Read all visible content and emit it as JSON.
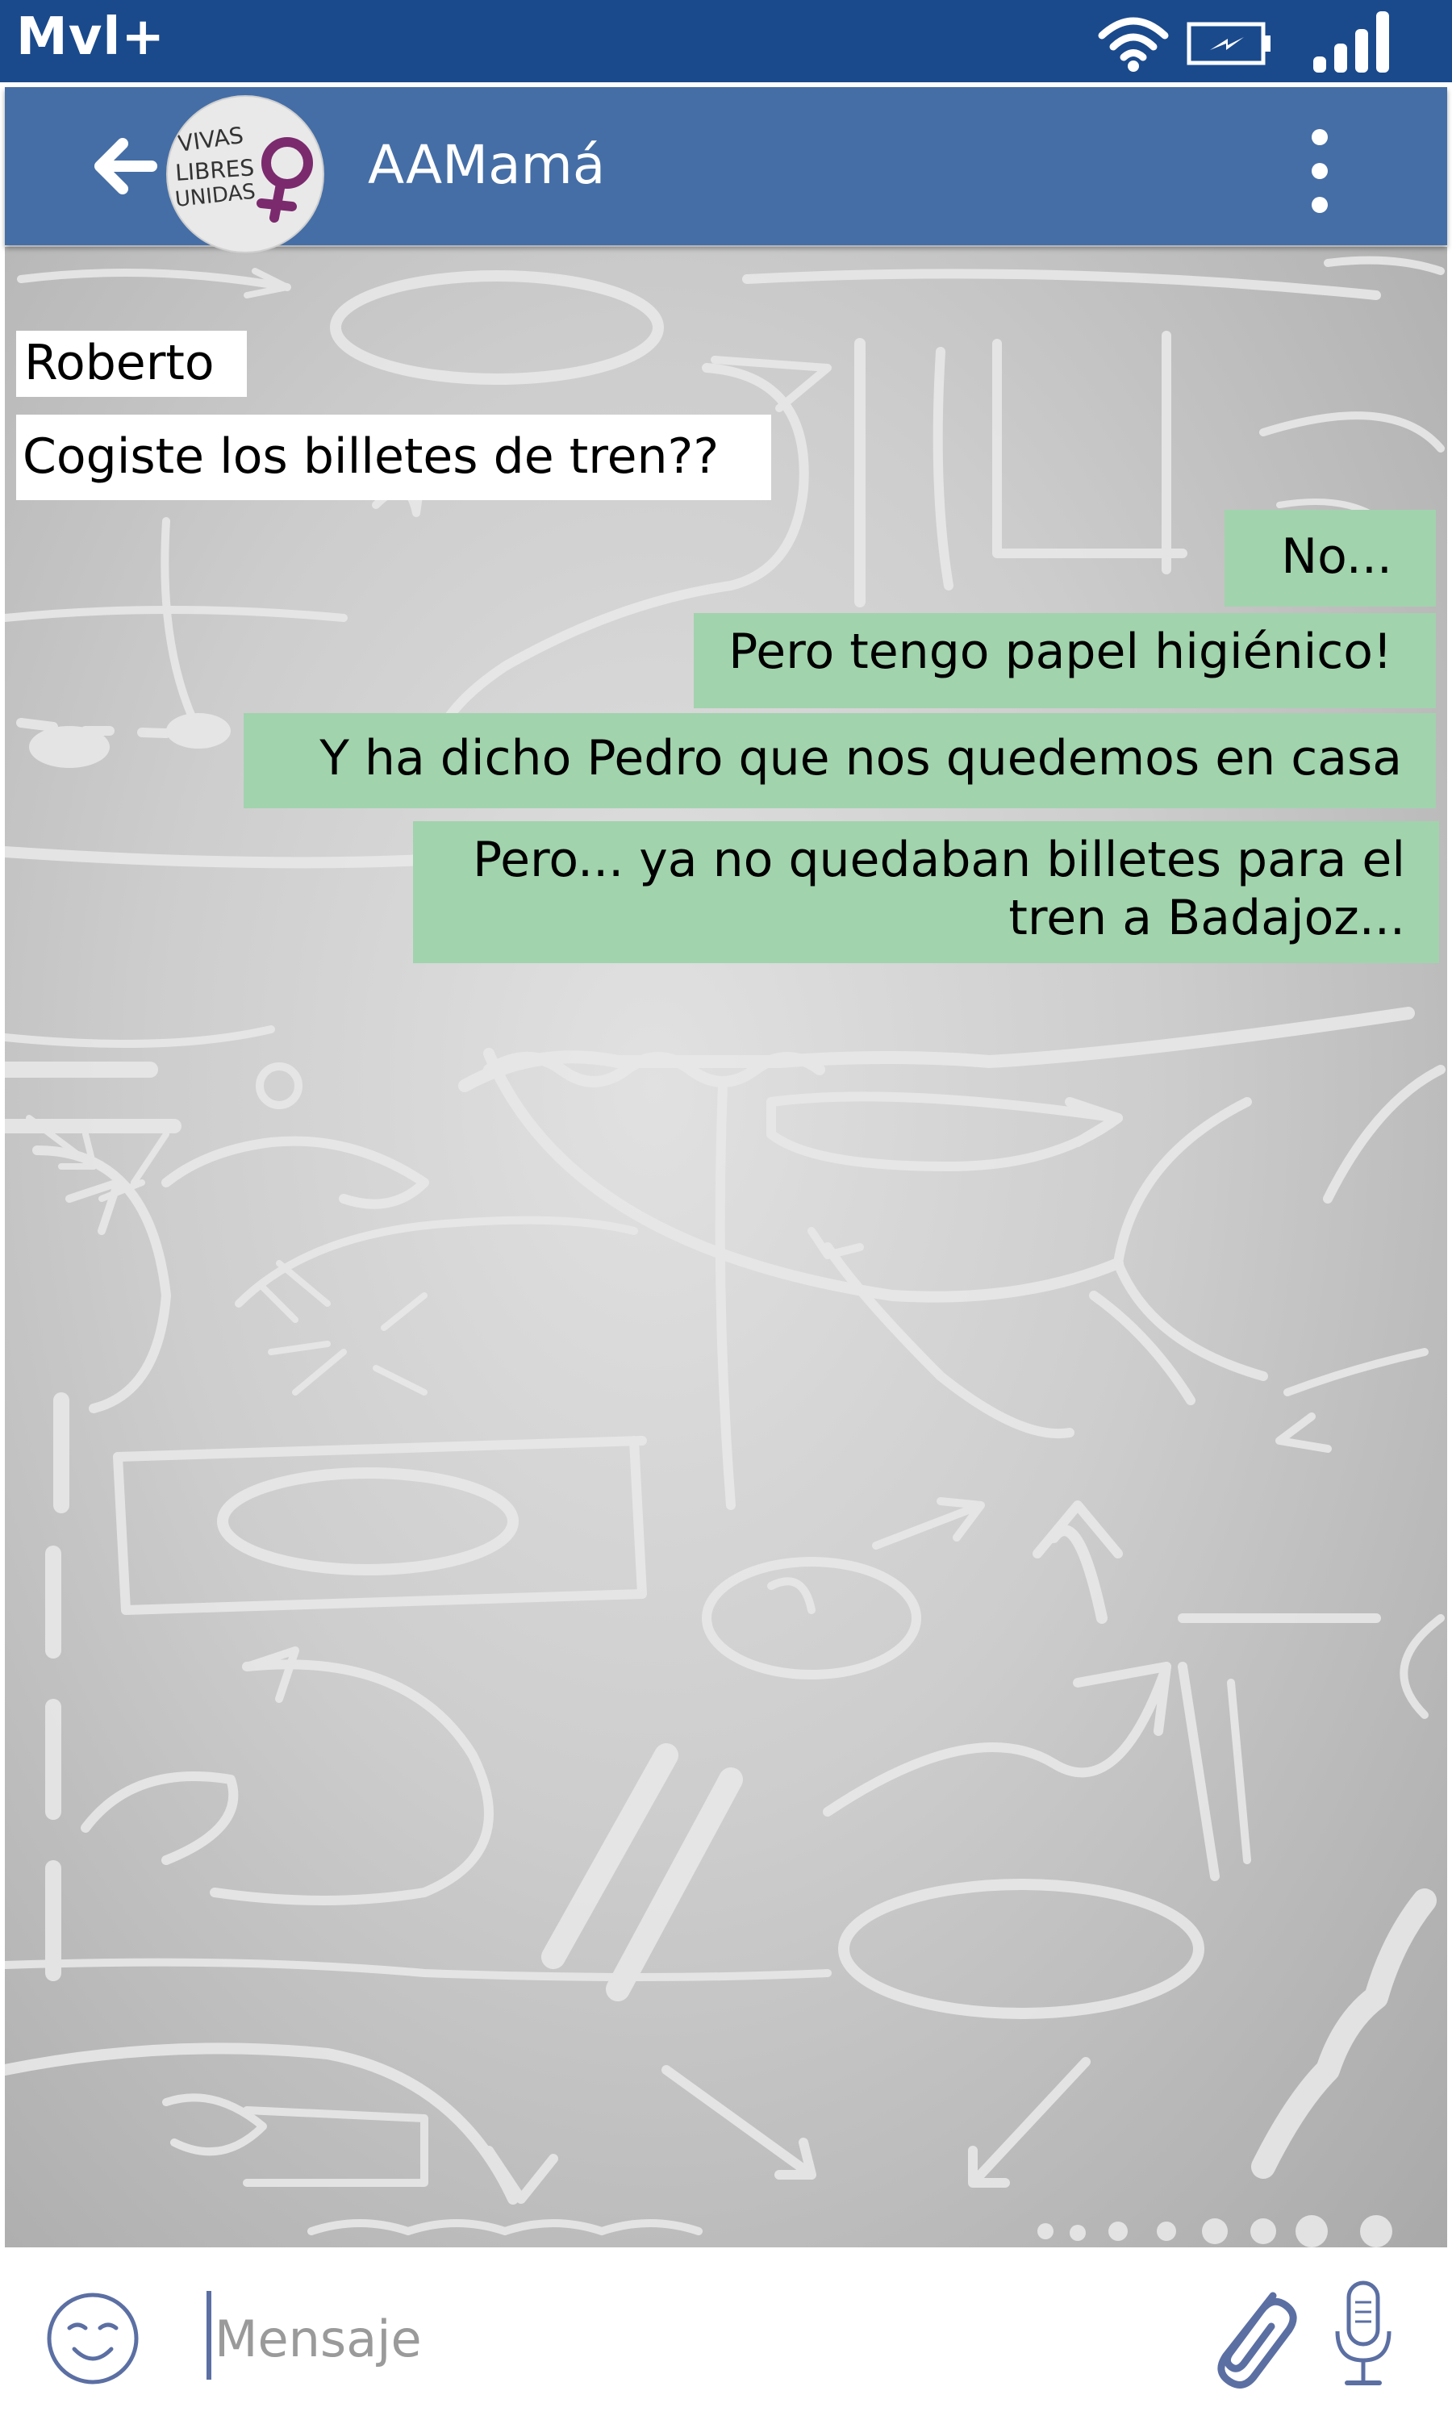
{
  "status_bar": {
    "carrier": "Mvl+",
    "icons": [
      "wifi-icon",
      "battery-charging-icon",
      "signal-icon"
    ],
    "background": "#1a4a8c"
  },
  "header": {
    "title": "AAMamá",
    "avatar_text": [
      "VIVAS",
      "LIBRES",
      "UNIDAS"
    ],
    "avatar_symbol_color": "#7b2a6e",
    "icons": [
      "arrow-left-icon",
      "more-vert-icon"
    ],
    "background": "#456ea6"
  },
  "messages": [
    {
      "direction": "incoming",
      "sender": "Roberto",
      "text": "Cogiste los billetes de tren??"
    },
    {
      "direction": "outgoing",
      "lines": [
        "No..."
      ]
    },
    {
      "direction": "outgoing",
      "lines": [
        "Pero tengo papel higiénico!"
      ]
    },
    {
      "direction": "outgoing",
      "lines": [
        "Y ha dicho Pedro que nos quedemos en casa"
      ]
    },
    {
      "direction": "outgoing",
      "lines": [
        "Pero... ya no quedaban billetes para el",
        "tren a Badajoz..."
      ]
    }
  ],
  "colors": {
    "incoming_bubble": "#ffffff",
    "outgoing_bubble": "#a1d3ad",
    "input_icons": "#5b6fa3"
  },
  "input": {
    "placeholder": "Mensaje",
    "value": "",
    "icons": [
      "smiley-icon",
      "paperclip-icon",
      "microphone-icon"
    ]
  }
}
